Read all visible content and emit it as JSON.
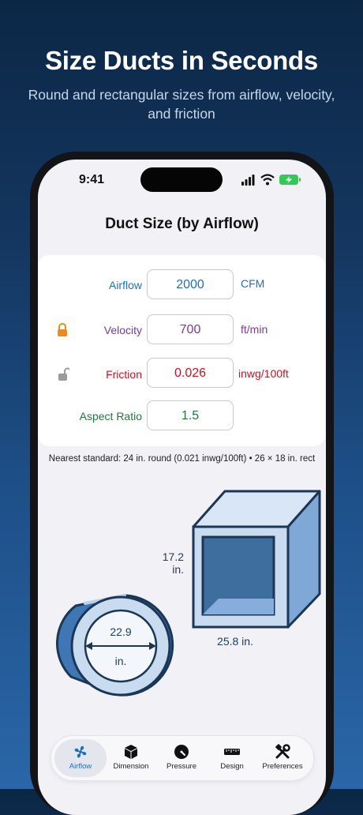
{
  "hero": {
    "title": "Size Ducts in Seconds",
    "subtitle": "Round and rectangular sizes from airflow, velocity, and friction"
  },
  "status_bar": {
    "time": "9:41"
  },
  "screen": {
    "title": "Duct Size (by Airflow)",
    "rows": [
      {
        "label": "Airflow",
        "value": "2000",
        "unit": "CFM",
        "color": "#1f6fc1",
        "lock": "none"
      },
      {
        "label": "Velocity",
        "value": "700",
        "unit": "ft/min",
        "color": "#7a3a9a",
        "lock": "locked-orange"
      },
      {
        "label": "Friction",
        "value": "0.026",
        "unit": "inwg/100ft",
        "color": "#d01020",
        "lock": "unlocked-gray"
      },
      {
        "label": "Aspect Ratio",
        "value": "1.5",
        "unit": "",
        "color": "#1e7a3a",
        "lock": "none"
      }
    ],
    "nearest_standard": "Nearest standard: 24 in. round (0.021 inwg/100ft) • 26 × 18 in. rect",
    "illustration": {
      "rect_height_value": "17.2",
      "rect_height_unit": "in.",
      "rect_width_label": "25.8  in.",
      "round_diameter_value": "22.9",
      "round_diameter_unit": "in."
    }
  },
  "tabs": [
    {
      "label": "Airflow",
      "icon": "fan-icon",
      "active": true
    },
    {
      "label": "Dimension",
      "icon": "cube-icon",
      "active": false
    },
    {
      "label": "Pressure",
      "icon": "gauge-icon",
      "active": false
    },
    {
      "label": "Design",
      "icon": "ruler-icon",
      "active": false
    },
    {
      "label": "Preferences",
      "icon": "tools-icon",
      "active": false
    }
  ],
  "colors": {
    "accent": "#1f6fc1",
    "velocity": "#7a3a9a",
    "friction": "#d01020",
    "aspect": "#1e7a3a",
    "lock_active": "#f08a1c"
  }
}
